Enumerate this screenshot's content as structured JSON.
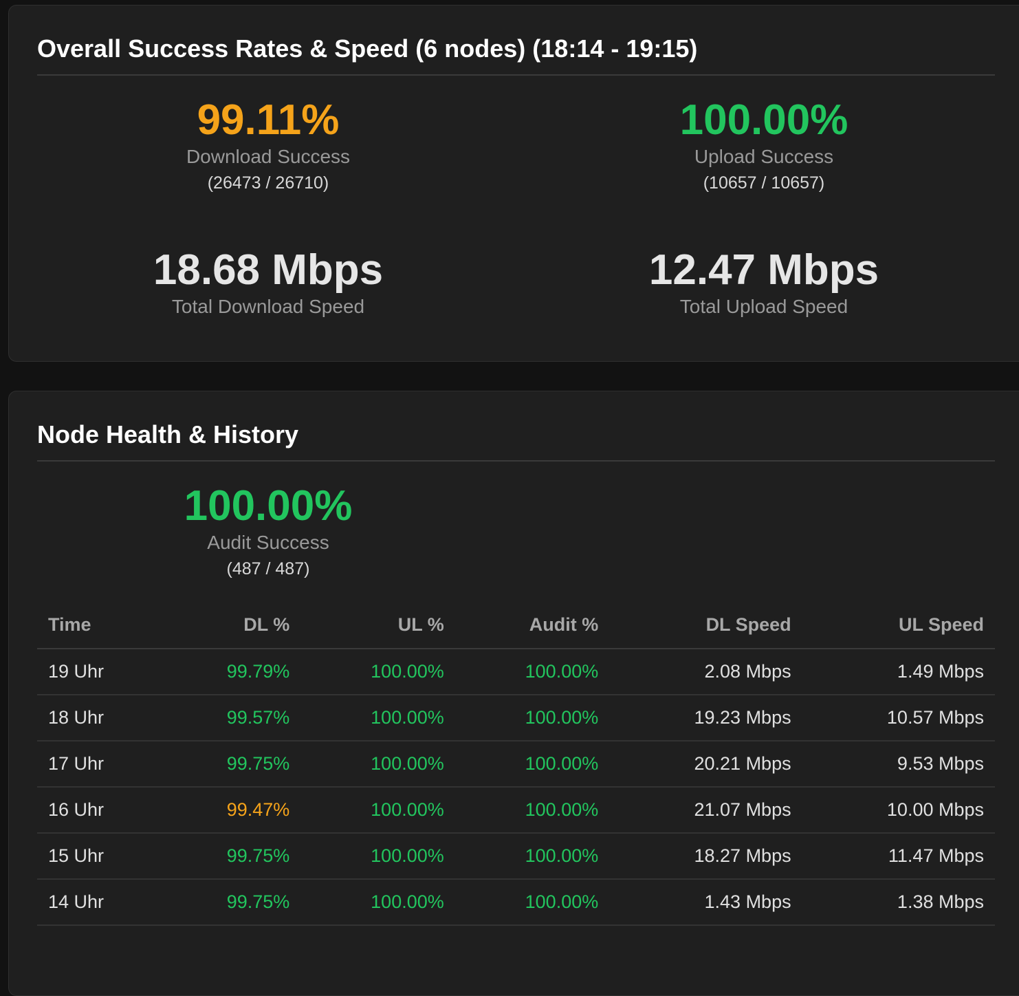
{
  "overall": {
    "title": "Overall Success Rates & Speed (6 nodes) (18:14 - 19:15)",
    "download_success": {
      "value": "99.11%",
      "label": "Download Success",
      "count": "(26473 / 26710)",
      "status": "warning"
    },
    "upload_success": {
      "value": "100.00%",
      "label": "Upload Success",
      "count": "(10657 / 10657)",
      "status": "good"
    },
    "download_speed": {
      "value": "18.68 Mbps",
      "label": "Total Download Speed"
    },
    "upload_speed": {
      "value": "12.47 Mbps",
      "label": "Total Upload Speed"
    }
  },
  "health": {
    "title": "Node Health & History",
    "audit_success": {
      "value": "100.00%",
      "label": "Audit Success",
      "count": "(487 / 487)",
      "status": "good"
    },
    "table": {
      "headers": [
        "Time",
        "DL %",
        "UL %",
        "Audit %",
        "DL Speed",
        "UL Speed"
      ],
      "rows": [
        {
          "time": "19 Uhr",
          "dl_pct": "99.79%",
          "dl_status": "good",
          "ul_pct": "100.00%",
          "audit_pct": "100.00%",
          "dl_speed": "2.08 Mbps",
          "ul_speed": "1.49 Mbps"
        },
        {
          "time": "18 Uhr",
          "dl_pct": "99.57%",
          "dl_status": "good",
          "ul_pct": "100.00%",
          "audit_pct": "100.00%",
          "dl_speed": "19.23 Mbps",
          "ul_speed": "10.57 Mbps"
        },
        {
          "time": "17 Uhr",
          "dl_pct": "99.75%",
          "dl_status": "good",
          "ul_pct": "100.00%",
          "audit_pct": "100.00%",
          "dl_speed": "20.21 Mbps",
          "ul_speed": "9.53 Mbps"
        },
        {
          "time": "16 Uhr",
          "dl_pct": "99.47%",
          "dl_status": "warning",
          "ul_pct": "100.00%",
          "audit_pct": "100.00%",
          "dl_speed": "21.07 Mbps",
          "ul_speed": "10.00 Mbps"
        },
        {
          "time": "15 Uhr",
          "dl_pct": "99.75%",
          "dl_status": "good",
          "ul_pct": "100.00%",
          "audit_pct": "100.00%",
          "dl_speed": "18.27 Mbps",
          "ul_speed": "11.47 Mbps"
        },
        {
          "time": "14 Uhr",
          "dl_pct": "99.75%",
          "dl_status": "good",
          "ul_pct": "100.00%",
          "audit_pct": "100.00%",
          "dl_speed": "1.43 Mbps",
          "ul_speed": "1.38 Mbps"
        }
      ]
    }
  },
  "colors": {
    "good": "#22c55e",
    "warning": "#f5a31a",
    "card": "#1f1f1f",
    "background": "#121212"
  }
}
